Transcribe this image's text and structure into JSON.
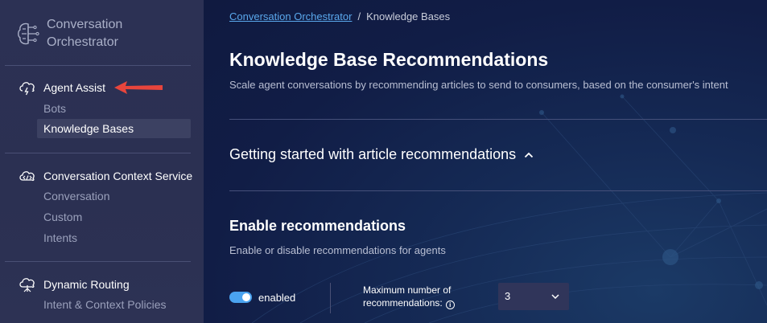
{
  "sidebar": {
    "brand": "Conversation Orchestrator",
    "sections": [
      {
        "title": "Agent Assist",
        "icon": "cloud-lightning-icon",
        "items": [
          "Bots",
          "Knowledge Bases"
        ]
      },
      {
        "title": "Conversation Context Service",
        "icon": "cloud-code-icon",
        "items": [
          "Conversation",
          "Custom",
          "Intents"
        ]
      },
      {
        "title": "Dynamic Routing",
        "icon": "cloud-routing-icon",
        "items": [
          "Intent & Context Policies"
        ]
      }
    ],
    "active_item": "Knowledge Bases",
    "annotation": "red-arrow-pointing-left"
  },
  "breadcrumb": {
    "root": "Conversation Orchestrator",
    "current": "Knowledge Bases",
    "separator": "/"
  },
  "page": {
    "title": "Knowledge Base Recommendations",
    "subtitle": "Scale agent conversations by recommending articles to send to consumers, based on the consumer's intent"
  },
  "accordion": {
    "title": "Getting started with article recommendations",
    "expanded": true
  },
  "recommendations": {
    "title": "Enable recommendations",
    "subtitle": "Enable or disable recommendations for agents",
    "toggle_on": true,
    "toggle_label": "enabled",
    "max_label": "Maximum number of recommendations:",
    "max_value": "3"
  },
  "colors": {
    "accent": "#4aa3f0",
    "link": "#5aa8ec",
    "sidebar_bg": "#2c3154",
    "arrow": "#e8453c"
  }
}
